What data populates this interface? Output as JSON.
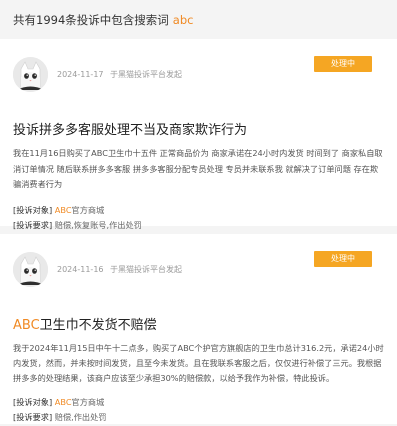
{
  "header": {
    "prefix": "共有1994条投诉中包含搜索词",
    "keyword": "abc"
  },
  "complaints": [
    {
      "date": "2024-11-17",
      "source": "于黑猫投诉平台发起",
      "status": "处理中",
      "title": "投诉拼多多客服处理不当及商家欺诈行为",
      "body": "我在11月16日购买了ABC卫生巾十五件 正常商品价为 商家承诺在24小时内发货 时间到了 商家私自取消订单情况 随后联系拼多多客服 拼多多客服分配专员处理 专员并未联系我 就解决了订单问题 存在欺骗消费者行为",
      "target_label": "[投诉对象]",
      "target_kw": "ABC",
      "target_rest": "官方商城",
      "request_label": "[投诉要求]",
      "request_value": "赔偿,恢复账号,作出处罚"
    },
    {
      "date": "2024-11-16",
      "source": "于黑猫投诉平台发起",
      "status": "处理中",
      "title_kw": "ABC",
      "title_rest": "卫生巾不发货不赔偿",
      "body": "我于2024年11月15日中午十二点多，购买了ABC个护官方旗舰店的卫生巾总计316.2元，承诺24小时内发货，然而，并未按时间发货，且至今未发货。且在我联系客服之后，仅仅进行补偿了三元。我根据拼多多的处理结果，该商户应该至少承担30%的赔偿款，以给予我作为补偿，特此投诉。",
      "target_label": "[投诉对象]",
      "target_kw": "ABC",
      "target_rest": "官方商城",
      "request_label": "[投诉要求]",
      "request_value": "赔偿,作出处罚"
    }
  ],
  "colors": {
    "accent": "#f08a24",
    "status_bg": "#f5a623",
    "page_bg": "#f4f4f4"
  },
  "icons": {
    "avatar": "cat-avatar-icon"
  }
}
